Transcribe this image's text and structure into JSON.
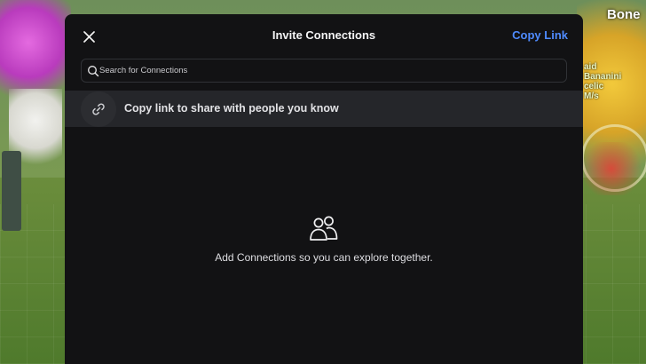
{
  "background": {
    "game_text_top": "Bone",
    "game_text_side": [
      "aid",
      "Bananini",
      "celic",
      "M/s"
    ]
  },
  "modal": {
    "title": "Invite Connections",
    "copy_link_label": "Copy Link",
    "close_icon": "close-icon",
    "search": {
      "placeholder": "Search for Connections",
      "value": "",
      "icon": "search-icon"
    },
    "share_row": {
      "icon": "link-icon",
      "label": "Copy link to share with people you know"
    },
    "empty_state": {
      "icon": "people-icon",
      "message": "Add Connections so you can explore together."
    }
  },
  "colors": {
    "modal_bg": "#121214",
    "row_bg": "#25262a",
    "accent": "#4f8bff",
    "text": "#f4f4f5"
  }
}
